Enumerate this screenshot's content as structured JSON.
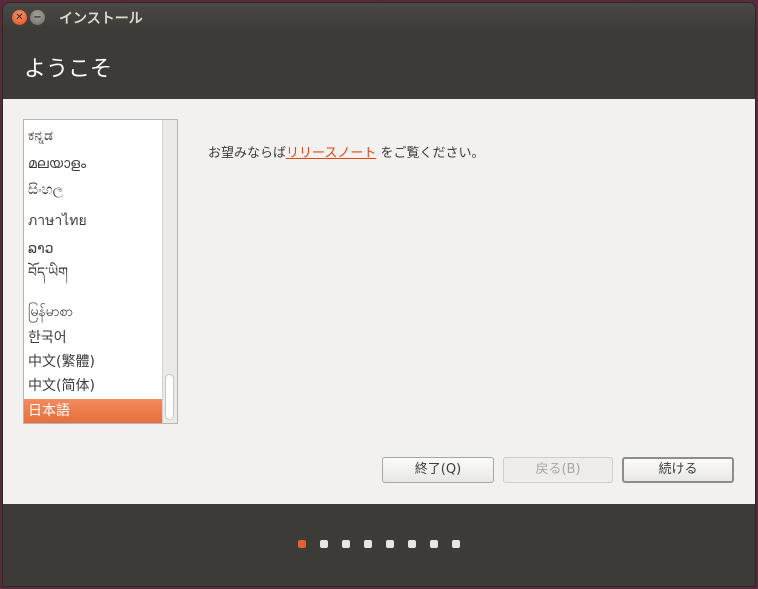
{
  "window": {
    "title": "インストール",
    "close_glyph": "✕",
    "min_glyph": "−"
  },
  "header": {
    "title": "ようこそ"
  },
  "languages": [
    "ಕನ್ನಡ",
    "മലയാളം",
    "සිංහල",
    "ภาษาไทย",
    "ລາວ",
    "བོད་ཡིག",
    "မြန်မာစာ",
    "한국어",
    "中文(繁體)",
    "中文(简体)",
    "日本語"
  ],
  "selected_language": "日本語",
  "release_note": {
    "prefix": "お望みならば",
    "link": "リリースノート",
    "suffix": "をご覧ください。"
  },
  "buttons": {
    "quit": "終了(Q)",
    "back": "戻る(B)",
    "next": "続ける"
  },
  "progress": {
    "total_steps": 8,
    "current_step": 1
  },
  "colors": {
    "accent": "#dd4814",
    "header_bg": "#3c3b37",
    "content_bg": "#f2f1f0"
  }
}
